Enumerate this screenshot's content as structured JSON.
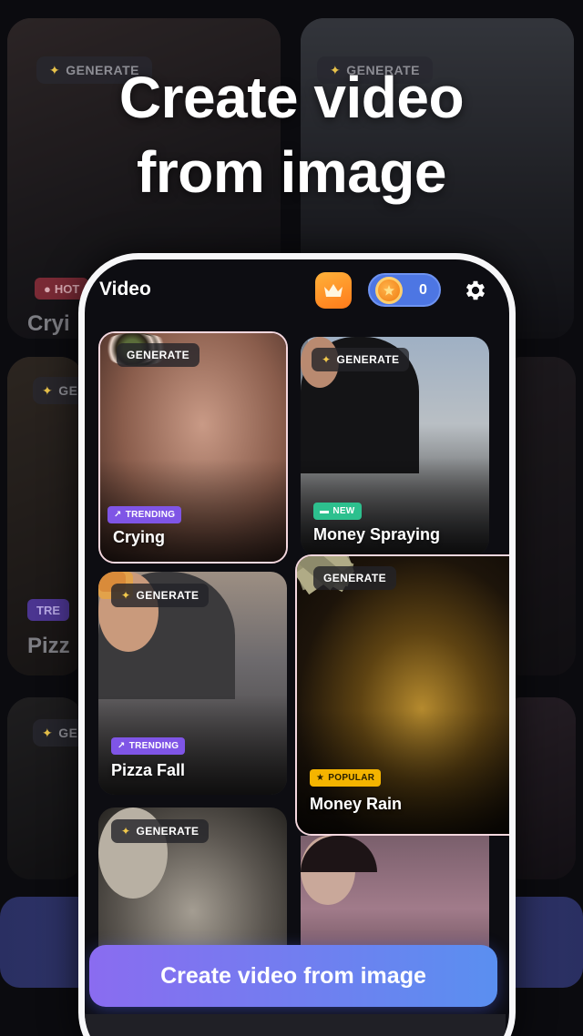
{
  "headline": {
    "line1": "Create video",
    "line2": "from image"
  },
  "background": {
    "cards": [
      {
        "pill": "GENERATE",
        "tag": "HOT",
        "title": "Cryi"
      },
      {
        "pill": "GENERATE"
      },
      {
        "pill": "GE",
        "tag": "TRE",
        "title": "Pizz"
      },
      {
        "pill": "GE"
      }
    ]
  },
  "app": {
    "title": "Video",
    "coins": "0",
    "icons": {
      "premium": "crown-icon",
      "coin": "coin-icon",
      "settings": "gear-icon"
    },
    "cards": [
      {
        "pill": "GENERATE",
        "tag": "TRENDING",
        "title": "Crying"
      },
      {
        "pill": "GENERATE",
        "tag": "NEW",
        "title": "Money Spraying"
      },
      {
        "pill": "GENERATE",
        "tag": "TRENDING",
        "title": "Pizza Fall"
      },
      {
        "pill": "GENERATE",
        "tag": "POPULAR",
        "title": "Money Rain"
      },
      {
        "pill": "GENERATE"
      }
    ],
    "cta": "Create video from image"
  },
  "colors": {
    "trending": "#7f55e6",
    "new": "#2dc08e",
    "popular": "#f4b400",
    "hot": "#c23a4d",
    "cta_start": "#8a6cf0",
    "cta_end": "#5a8ff0"
  }
}
